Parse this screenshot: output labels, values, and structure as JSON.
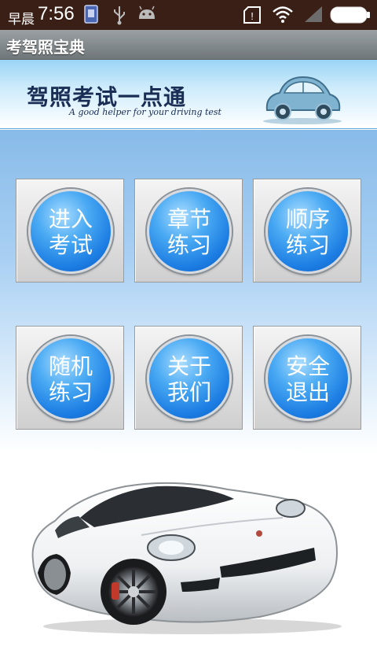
{
  "status_bar": {
    "period": "早晨",
    "time": "7:56",
    "icons": [
      "notification-icon",
      "usb-icon",
      "android-icon",
      "sim-icon",
      "wifi-icon",
      "signal-icon",
      "battery-icon"
    ]
  },
  "app": {
    "title": "考驾照宝典"
  },
  "banner": {
    "title": "驾照考试一点通",
    "subtitle": "A good helper for your driving test"
  },
  "menu": [
    {
      "line1": "进入",
      "line2": "考试"
    },
    {
      "line1": "章节",
      "line2": "练习"
    },
    {
      "line1": "顺序",
      "line2": "练习"
    },
    {
      "line1": "随机",
      "line2": "练习"
    },
    {
      "line1": "关于",
      "line2": "我们"
    },
    {
      "line1": "安全",
      "line2": "退出"
    }
  ],
  "colors": {
    "status_bar": "#3a1f16",
    "accent_blue": "#1c7de3",
    "banner_text": "#1a2d55"
  }
}
